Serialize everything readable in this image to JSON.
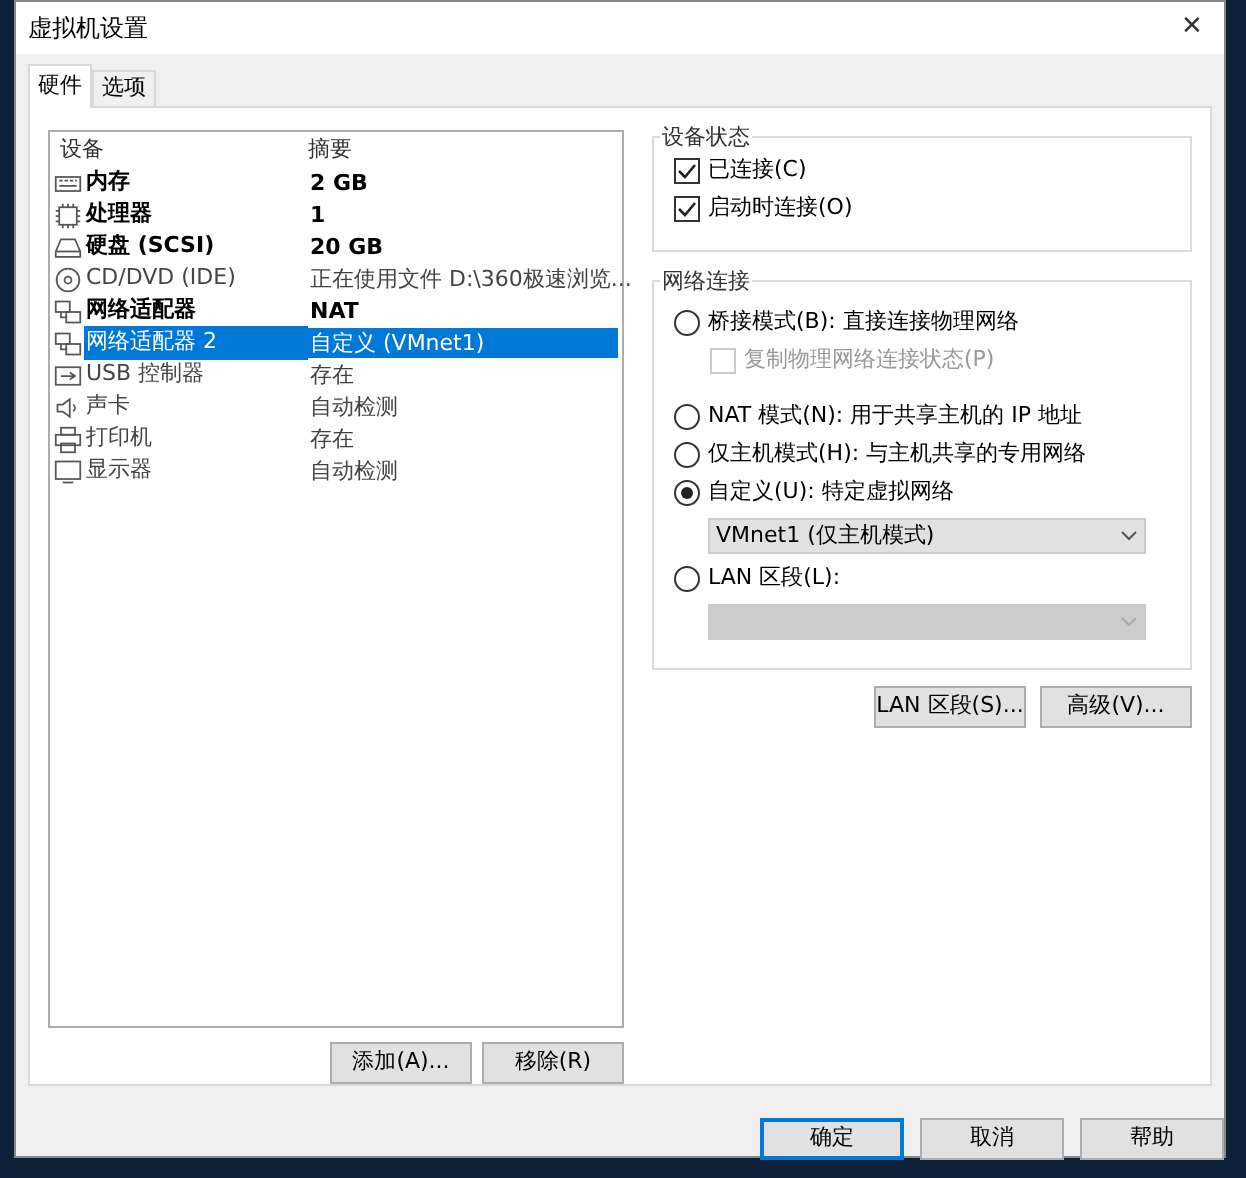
{
  "window": {
    "title": "虚拟机设置",
    "close": "✕"
  },
  "tabs": [
    {
      "label": "硬件",
      "selected": true
    },
    {
      "label": "选项",
      "selected": false
    }
  ],
  "device_list": {
    "columns": [
      "设备",
      "摘要"
    ],
    "rows": [
      {
        "kind": "memory",
        "device": "内存",
        "summary": "2 GB",
        "selected": false,
        "dimmed": false
      },
      {
        "kind": "cpu",
        "device": "处理器",
        "summary": "1",
        "selected": false,
        "dimmed": false
      },
      {
        "kind": "disk",
        "device": "硬盘 (SCSI)",
        "summary": "20 GB",
        "selected": false,
        "dimmed": false
      },
      {
        "kind": "cd",
        "device": "CD/DVD (IDE)",
        "summary": "正在使用文件 D:\\360极速浏览...",
        "selected": false,
        "dimmed": true
      },
      {
        "kind": "network",
        "device": "网络适配器",
        "summary": "NAT",
        "selected": false,
        "dimmed": false
      },
      {
        "kind": "network",
        "device": "网络适配器 2",
        "summary": "自定义 (VMnet1)",
        "selected": true
      },
      {
        "kind": "usb",
        "device": "USB 控制器",
        "summary": "存在",
        "selected": false,
        "dimmed": true
      },
      {
        "kind": "sound",
        "device": "声卡",
        "summary": "自动检测",
        "selected": false,
        "dimmed": true
      },
      {
        "kind": "printer",
        "device": "打印机",
        "summary": "存在",
        "selected": false,
        "dimmed": true
      },
      {
        "kind": "display",
        "device": "显示器",
        "summary": "自动检测",
        "selected": false,
        "dimmed": true
      }
    ]
  },
  "list_buttons": [
    "添加(A)...",
    "移除(R)"
  ],
  "device_status": {
    "title": "设备状态",
    "options": [
      {
        "label": "已连接(C)",
        "checked": true
      },
      {
        "label": "启动时连接(O)",
        "checked": true
      }
    ]
  },
  "network_connection": {
    "title": "网络连接",
    "options": [
      {
        "kind": "radio",
        "label": "桥接模式(B): 直接连接物理网络",
        "selected": false
      },
      {
        "kind": "checkbox",
        "label": "复制物理网络连接状态(P)",
        "checked": false,
        "disabled": true
      },
      {
        "kind": "radio",
        "label": "NAT 模式(N): 用于共享主机的 IP 地址",
        "selected": false
      },
      {
        "kind": "radio",
        "label": "仅主机模式(H): 与主机共享的专用网络",
        "selected": false
      },
      {
        "kind": "radio",
        "label": "自定义(U): 特定虚拟网络",
        "selected": true
      },
      {
        "kind": "dropdown",
        "value": "VMnet1 (仅主机模式)",
        "disabled": false
      },
      {
        "kind": "radio",
        "label": "LAN 区段(L):",
        "selected": false
      },
      {
        "kind": "dropdown",
        "disabled": true
      }
    ]
  },
  "network_buttons": [
    "LAN 区段(S)...",
    "高级(V)..."
  ],
  "dialog_buttons": [
    {
      "label": "确定",
      "default": true
    },
    {
      "label": "取消",
      "default": false
    },
    {
      "label": "帮助",
      "default": false
    }
  ]
}
